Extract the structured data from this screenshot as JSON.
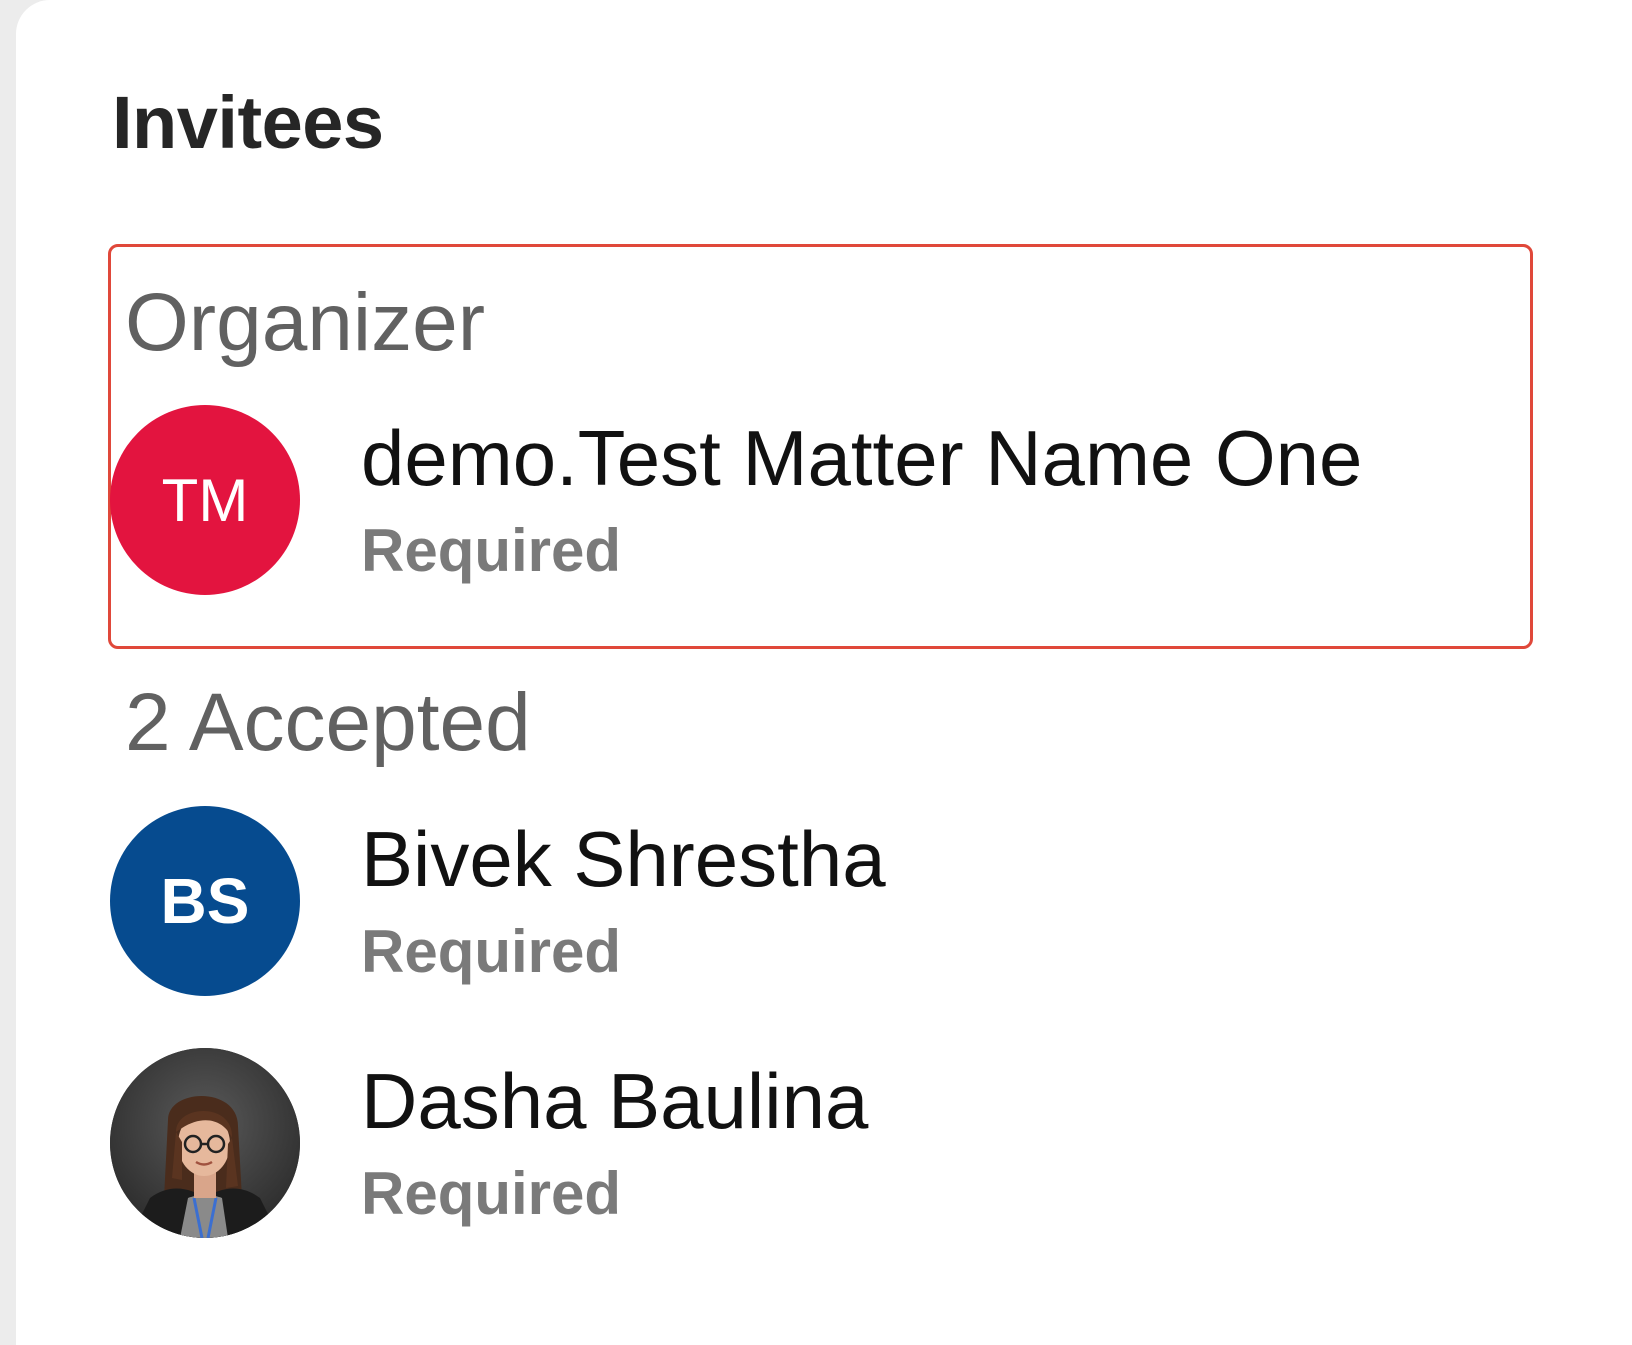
{
  "panel": {
    "title": "Invitees"
  },
  "organizer": {
    "section_label": "Organizer",
    "person": {
      "initials": "TM",
      "name": "demo.Test Matter Name One",
      "role": "Required",
      "avatar_color": "#e3143f"
    }
  },
  "accepted": {
    "section_label": "2 Accepted",
    "people": [
      {
        "initials": "BS",
        "name": "Bivek Shrestha",
        "role": "Required",
        "avatar_color": "#064b8f"
      },
      {
        "name": "Dasha Baulina",
        "role": "Required",
        "avatar": "photo-avatar"
      }
    ]
  },
  "colors": {
    "highlight_border": "#e0483a",
    "secondary_text": "#616161",
    "role_text": "#7a7a7a"
  }
}
